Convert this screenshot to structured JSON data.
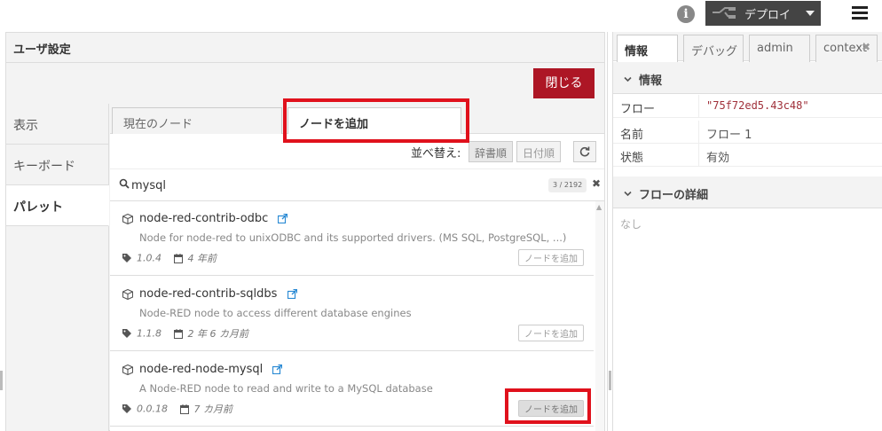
{
  "header": {
    "info_label": "i",
    "deploy_label": "デプロイ"
  },
  "dialog": {
    "title": "ユーザ設定",
    "close_label": "閉じる",
    "nav": [
      "表示",
      "キーボード",
      "パレット"
    ],
    "tabs": {
      "current": "現在のノード",
      "install": "ノードを追加"
    },
    "sort": {
      "label": "並べ替え:",
      "alpha": "辞書順",
      "date": "日付順"
    },
    "search": {
      "value": "mysql",
      "count": "3 / 2192"
    },
    "nodes": [
      {
        "name": "node-red-contrib-odbc",
        "desc": "Node for node-red to unixODBC and its supported drivers. (MS SQL, PostgreSQL, ...)",
        "version": "1.0.4",
        "updated": "4 年前",
        "install": "ノードを追加"
      },
      {
        "name": "node-red-contrib-sqldbs",
        "desc": "Node-RED node to access different database engines",
        "version": "1.1.8",
        "updated": "2 年 6 カ月前",
        "install": "ノードを追加"
      },
      {
        "name": "node-red-node-mysql",
        "desc": "A Node-RED node to read and write to a MySQL database",
        "version": "0.0.18",
        "updated": "7 カ月前",
        "install": "ノードを追加"
      }
    ]
  },
  "sidebar": {
    "tabs": [
      "情報",
      "デバッグ",
      "admin",
      "context"
    ],
    "info_section": "情報",
    "props": [
      {
        "key": "フロー",
        "value": "\"75f72ed5.43c48\""
      },
      {
        "key": "名前",
        "value": "フロー 1"
      },
      {
        "key": "状態",
        "value": "有効"
      }
    ],
    "details_section": "フローの詳細",
    "details_empty": "なし"
  },
  "colors": {
    "accent_red": "#ad1625",
    "highlight": "#e0111c",
    "deploy_bg": "#444444"
  }
}
